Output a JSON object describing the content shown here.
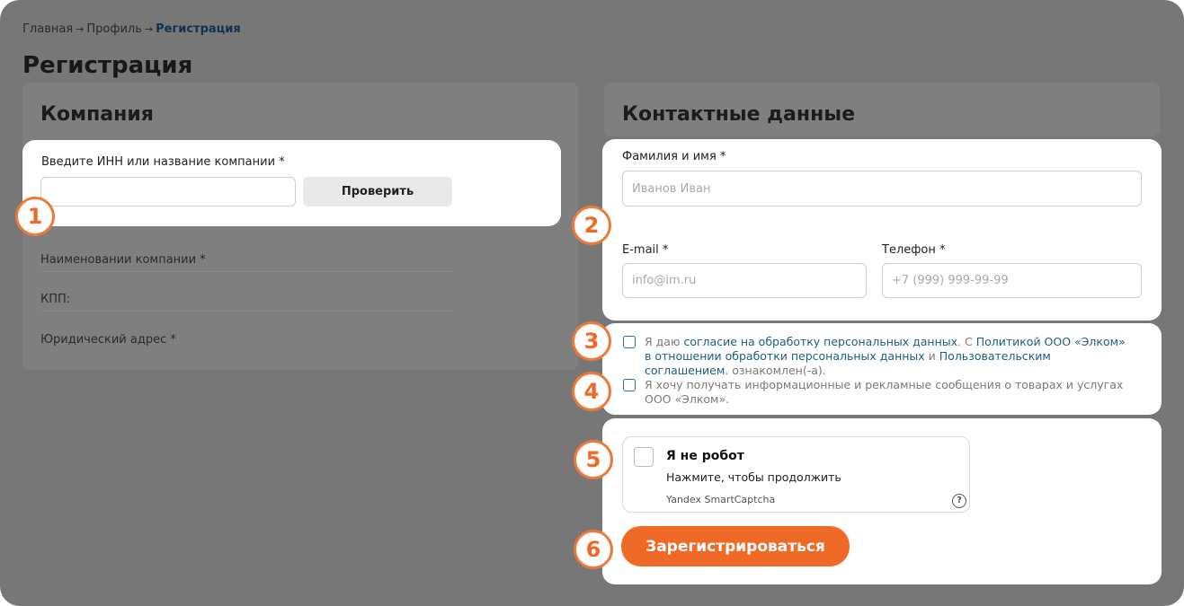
{
  "breadcrumb": {
    "items": [
      "Главная",
      "Профиль"
    ],
    "current": "Регистрация",
    "separator": "→"
  },
  "page_title": "Регистрация",
  "company": {
    "heading": "Компания",
    "inn_label": "Введите ИНН или название компании *",
    "inn_value": "",
    "check_button": "Проверить",
    "fields": [
      "Наименовании компании *",
      "КПП:",
      "Юридический адрес *"
    ]
  },
  "contacts": {
    "heading": "Контактные данные",
    "name_label": "Фамилия и имя *",
    "name_placeholder": "Иванов Иван",
    "email_label": "E-mail *",
    "email_placeholder": "info@im.ru",
    "phone_label": "Телефон *",
    "phone_placeholder": "+7 (999) 999-99-99"
  },
  "consent": {
    "c1_t1": "Я даю ",
    "c1_l1": "согласие на обработку персональных данных",
    "c1_t2": ". С ",
    "c1_l2": "Политикой ООО «Элком» в отношении обработки персональных данных",
    "c1_t3": " и ",
    "c1_l3": "Пользовательским соглашением",
    "c1_t4": ". ознакомлен(-а).",
    "c2": "Я хочу получать информационные и рекламные сообщения о товарах и услугах ООО «Элком»."
  },
  "captcha": {
    "title": "Я не робот",
    "subtitle": "Нажмите, чтобы продолжить",
    "brand": "Yandex SmartCaptcha",
    "help": "?"
  },
  "register_button": "Зарегистрироваться",
  "steps": [
    "1",
    "2",
    "3",
    "4",
    "5",
    "6"
  ],
  "colors": {
    "overlay": "#777777",
    "accent": "#ee6a26",
    "link": "#1c5e7e",
    "panel": "#ffffff"
  }
}
